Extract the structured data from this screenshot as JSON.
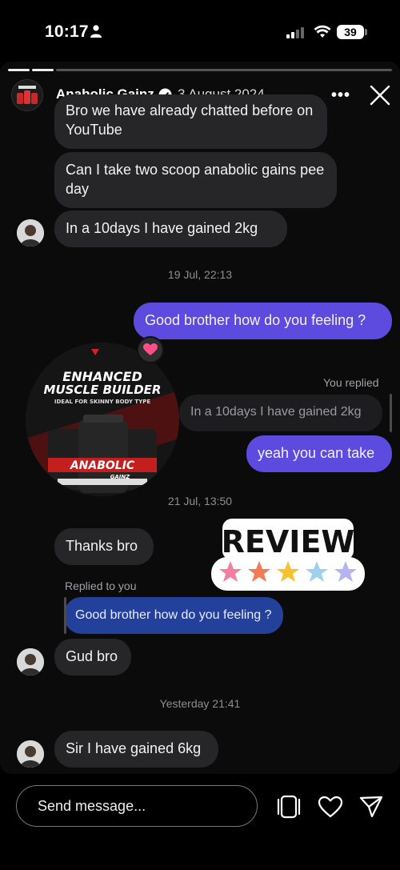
{
  "status": {
    "time": "10:17",
    "battery": "39"
  },
  "story": {
    "account_name": "Anabolic Gainz",
    "date": "3 August 2024"
  },
  "chat": {
    "msg1": "Bro we have already chatted before on YouTube",
    "msg2": "Can I take  two scoop anabolic gains pee day",
    "msg3": "In a 10days  I have gained  2kg",
    "ts1": "19 Jul, 22:13",
    "me1": "Good brother how do you feeling ?",
    "you_replied": "You replied",
    "quoted_reply": "In a 10days  I have gained  2kg",
    "me2": "yeah you can take",
    "ts2": "21 Jul, 13:50",
    "msg4": "Thanks bro",
    "replied_to_you": "Replied to you",
    "quoted_me": "Good brother how do you feeling ?",
    "msg5": "Gud bro",
    "ts3": "Yesterday 21:41",
    "msg6": "Sir I have gained 6kg"
  },
  "product": {
    "line1": "ENHANCED",
    "line2": "MUSCLE BUILDER",
    "line3": "IDEAL FOR SKINNY BODY TYPE",
    "brand": "ANABOLIC",
    "brand2": "GAINZ"
  },
  "sticker": {
    "text": "REVIEW",
    "stars": 5
  },
  "composer": {
    "placeholder": "Send message..."
  },
  "colors": {
    "my_bubble": "#5d4be0",
    "their_bubble": "#262628",
    "quote_bubble": "#23409a"
  }
}
